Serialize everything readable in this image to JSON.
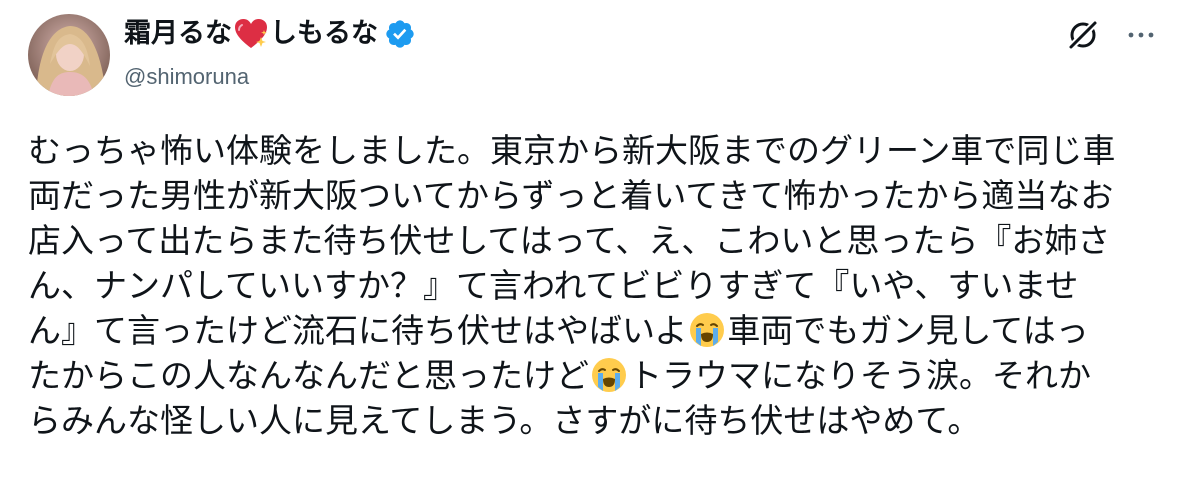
{
  "tweet": {
    "author": {
      "name_prefix": "霜月るな",
      "name_suffix": "しもるな",
      "handle": "@shimoruna",
      "verified": true,
      "accent_color": "#1d9bf0"
    },
    "header_icons": [
      "grok-icon",
      "more-icon"
    ],
    "text_lines": [
      [
        "むっちゃ怖い体験をしました。東京から新大阪までのグリーン車で同じ車"
      ],
      [
        "両だった男性が新大阪ついてからずっと着いてきて怖かったから適当なお"
      ],
      [
        "店入って出たらまた待ち伏せしてはって、え、こわいと思ったら『お姉さ"
      ],
      [
        "ん、ナンパしていいすか？』て言われてビビりすぎて『いや、すいませ"
      ],
      [
        "ん』て言ったけど流石に待ち伏せはやばいよ",
        "車両でもガン見してはっ"
      ],
      [
        "たからこの人なんなんだと思ったけど",
        "トラウマになりそう涙。それか"
      ],
      [
        "らみんな怪しい人に見えてしまう。さすがに待ち伏せはやめて。"
      ]
    ],
    "inline_emoji": "crying-face-emoji",
    "name_emoji": "sparkling-heart-emoji"
  }
}
